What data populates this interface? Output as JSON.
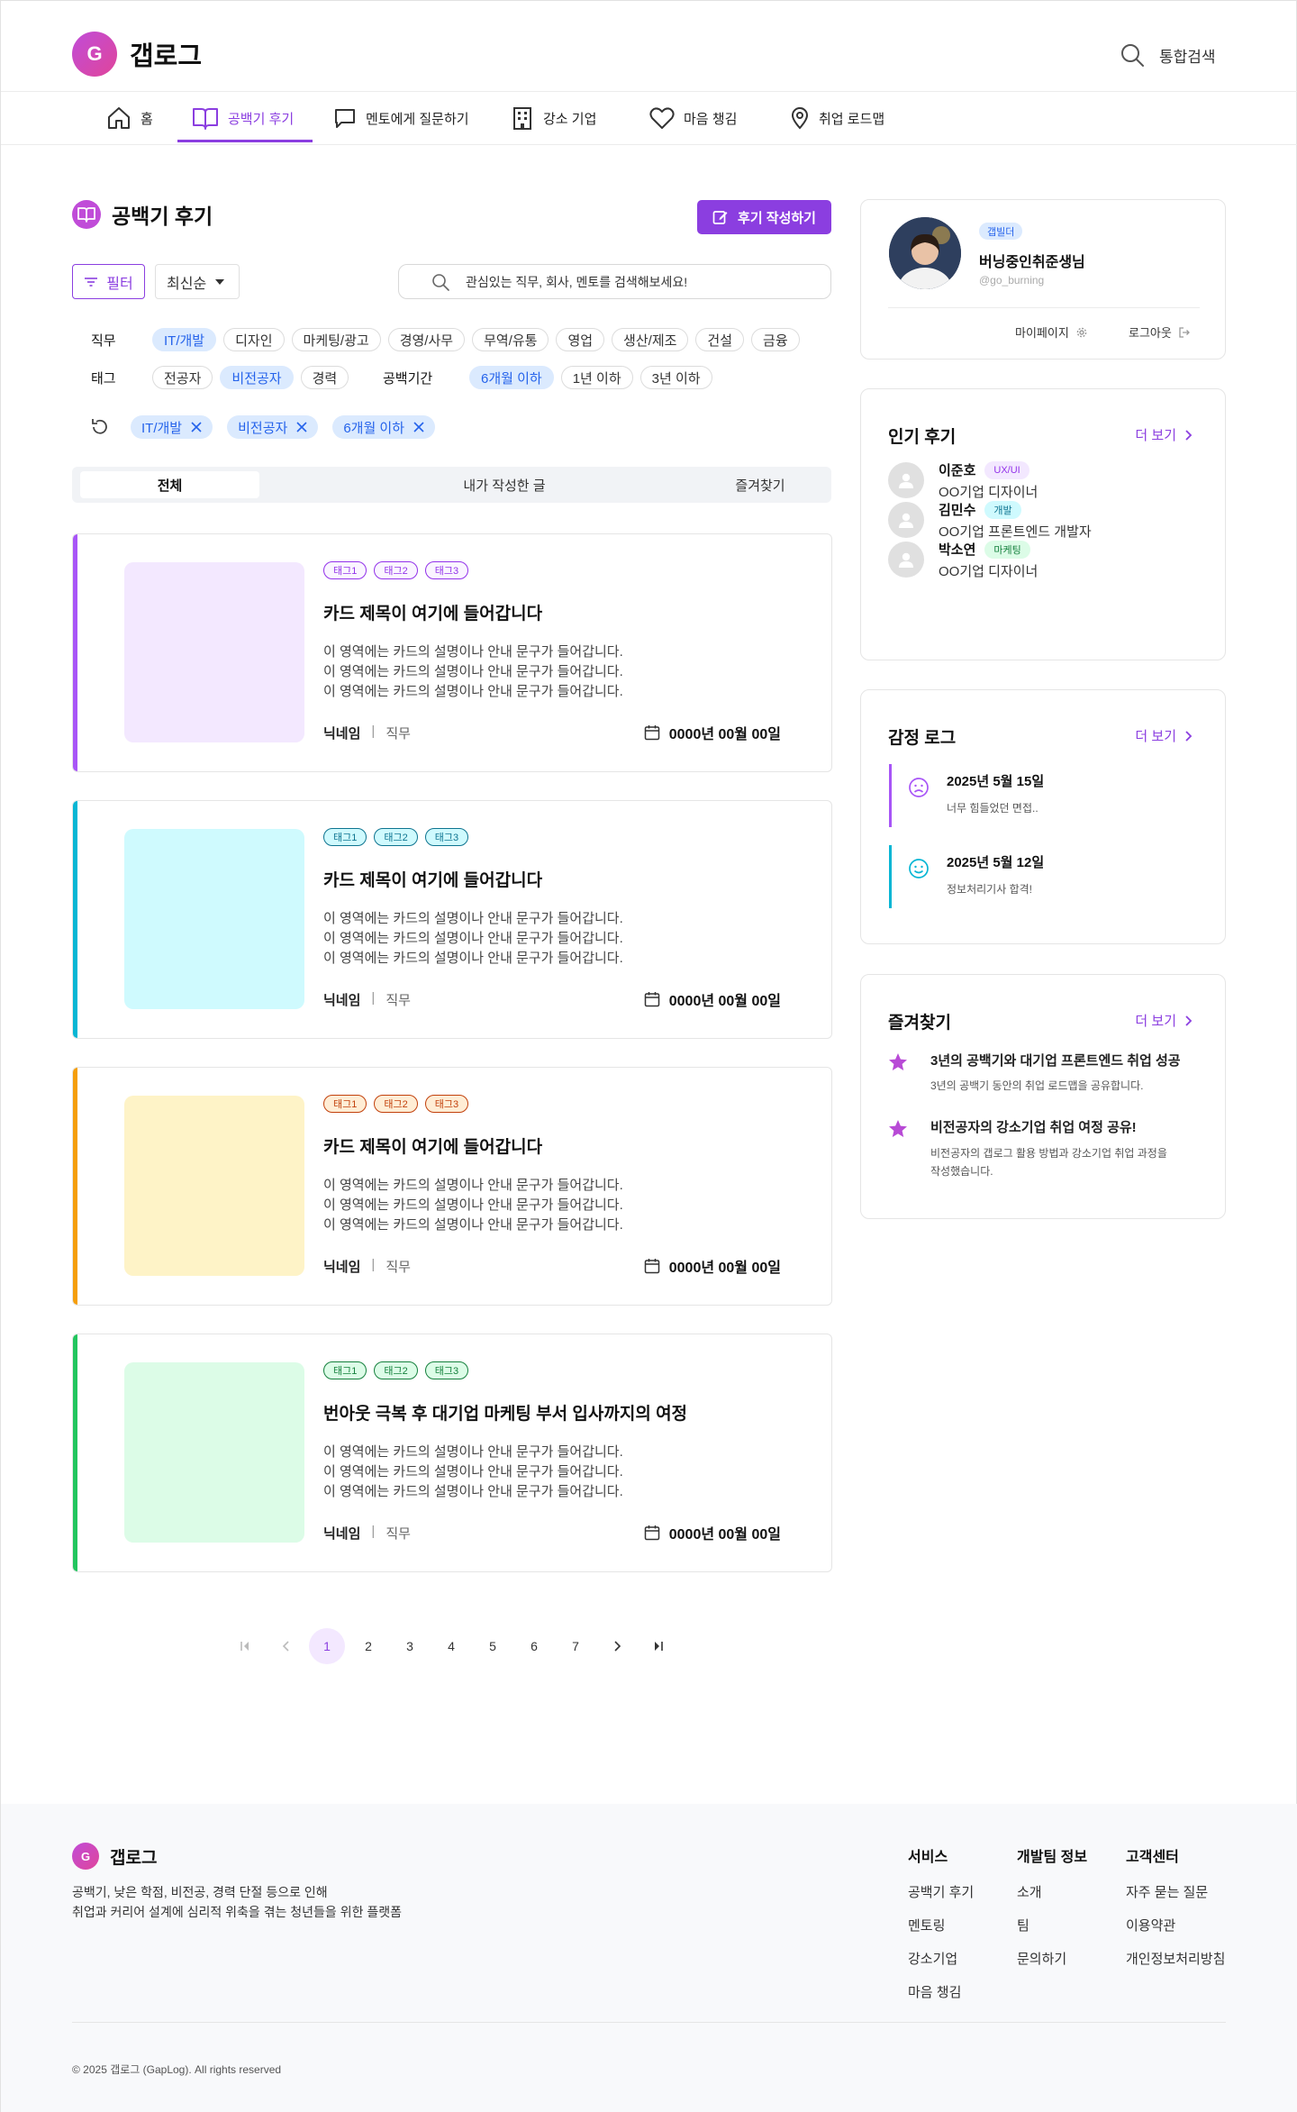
{
  "header": {
    "logo_letter": "G",
    "brand": "갭로그",
    "search_label": "통합검색"
  },
  "nav": {
    "items": [
      {
        "label": "홈"
      },
      {
        "label": "공백기 후기"
      },
      {
        "label": "멘토에게 질문하기"
      },
      {
        "label": "강소 기업"
      },
      {
        "label": "마음 챙김"
      },
      {
        "label": "취업 로드맵"
      }
    ],
    "active_index": 1
  },
  "main": {
    "page_title": "공백기 후기",
    "write_button": "후기 작성하기",
    "filter_button": "필터",
    "sort_label": "최신순",
    "search_placeholder": "관심있는 직무, 회사, 멘토를 검색해보세요!",
    "filters": {
      "job_label": "직무",
      "jobs": [
        "IT/개발",
        "디자인",
        "마케팅/광고",
        "경영/사무",
        "무역/유통",
        "영업",
        "생산/제조",
        "건설",
        "금융"
      ],
      "tag_label": "태그",
      "tags": [
        "전공자",
        "비전공자",
        "경력"
      ],
      "period_label": "공백기간",
      "periods": [
        "6개월 이하",
        "1년 이하",
        "3년 이하"
      ]
    },
    "active_chips": [
      "IT/개발",
      "비전공자",
      "6개월 이하"
    ],
    "tabs": [
      "전체",
      "내가 작성한 글",
      "즐겨찾기"
    ],
    "cards": [
      {
        "tags": [
          "태그1",
          "태그2",
          "태그3"
        ],
        "title": "카드 제목이 여기에 들어갑니다",
        "desc": [
          "이 영역에는 카드의 설명이나 안내 문구가 들어갑니다.",
          "이 영역에는 카드의 설명이나 안내 문구가 들어갑니다.",
          "이 영역에는 카드의 설명이나 안내 문구가 들어갑니다."
        ],
        "nickname": "닉네임",
        "job": "직무",
        "date": "0000년 00월 00일",
        "accent": "#a855f7",
        "thumb": "#f3e8ff",
        "tag_color": "#9333ea",
        "tag_bg": "#faf5ff"
      },
      {
        "tags": [
          "태그1",
          "태그2",
          "태그3"
        ],
        "title": "카드 제목이 여기에 들어갑니다",
        "desc": [
          "이 영역에는 카드의 설명이나 안내 문구가 들어갑니다.",
          "이 영역에는 카드의 설명이나 안내 문구가 들어갑니다.",
          "이 영역에는 카드의 설명이나 안내 문구가 들어갑니다."
        ],
        "nickname": "닉네임",
        "job": "직무",
        "date": "0000년 00월 00일",
        "accent": "#06b6d4",
        "thumb": "#cffafe",
        "tag_color": "#0e7490",
        "tag_bg": "#cffafe"
      },
      {
        "tags": [
          "태그1",
          "태그2",
          "태그3"
        ],
        "title": "카드 제목이 여기에 들어갑니다",
        "desc": [
          "이 영역에는 카드의 설명이나 안내 문구가 들어갑니다.",
          "이 영역에는 카드의 설명이나 안내 문구가 들어갑니다.",
          "이 영역에는 카드의 설명이나 안내 문구가 들어갑니다."
        ],
        "nickname": "닉네임",
        "job": "직무",
        "date": "0000년 00월 00일",
        "accent": "#f59e0b",
        "thumb": "#fef3c7",
        "tag_color": "#c2410c",
        "tag_bg": "#ffedd5"
      },
      {
        "tags": [
          "태그1",
          "태그2",
          "태그3"
        ],
        "title": "번아웃 극복 후 대기업 마케팅 부서 입사까지의 여정",
        "desc": [
          "이 영역에는 카드의 설명이나 안내 문구가 들어갑니다.",
          "이 영역에는 카드의 설명이나 안내 문구가 들어갑니다.",
          "이 영역에는 카드의 설명이나 안내 문구가 들어갑니다."
        ],
        "nickname": "닉네임",
        "job": "직무",
        "date": "0000년 00월 00일",
        "accent": "#22c55e",
        "thumb": "#dcfce7",
        "tag_color": "#15803d",
        "tag_bg": "#dcfce7"
      }
    ],
    "pagination": {
      "pages": [
        "1",
        "2",
        "3",
        "4",
        "5",
        "6",
        "7"
      ],
      "current": "1"
    }
  },
  "sidebar": {
    "profile": {
      "badge": "갭빌더",
      "name": "버닝중인취준생님",
      "handle": "@go_burning",
      "mypage": "마이페이지",
      "logout": "로그아웃"
    },
    "popular": {
      "title": "인기 후기",
      "more": "더 보기",
      "items": [
        {
          "name": "이준호",
          "role": "UX/UI",
          "desc": "OO기업 디자이너",
          "role_color": "#9333ea",
          "role_bg": "#f3e8ff"
        },
        {
          "name": "김민수",
          "role": "개발",
          "desc": "OO기업 프론트엔드 개발자",
          "role_color": "#0e7490",
          "role_bg": "#cffafe"
        },
        {
          "name": "박소연",
          "role": "마케팅",
          "desc": "OO기업 디자이너",
          "role_color": "#15803d",
          "role_bg": "#dcfce7"
        }
      ]
    },
    "emotion": {
      "title": "감정 로그",
      "more": "더 보기",
      "items": [
        {
          "date": "2025년 5월 15일",
          "text": "너무 힘들었던 면접..",
          "mood": "sad"
        },
        {
          "date": "2025년 5월 12일",
          "text": "정보처리기사 합격!",
          "mood": "happy"
        }
      ]
    },
    "favorites": {
      "title": "즐겨찾기",
      "more": "더 보기",
      "items": [
        {
          "title": "3년의 공백기와 대기업 프론트엔드 취업 성공",
          "desc": [
            "3년의 공백기 동안의 취업 로드맵을 공유합니다."
          ]
        },
        {
          "title": "비전공자의 강소기업 취업 여정 공유!",
          "desc": [
            "비전공자의 갭로그 활용 방법과 강소기업 취업 과정을",
            "작성했습니다."
          ]
        }
      ]
    }
  },
  "footer": {
    "logo_letter": "G",
    "brand": "갭로그",
    "tagline": [
      "공백기, 낮은 학점, 비전공, 경력 단절 등으로 인해",
      "취업과 커리어 설계에 심리적 위축을 겪는 청년들을 위한 플랫폼"
    ],
    "columns": [
      {
        "title": "서비스",
        "links": [
          "공백기 후기",
          "멘토링",
          "강소기업",
          "마음 챙김"
        ]
      },
      {
        "title": "개발팀 정보",
        "links": [
          "소개",
          "팀",
          "문의하기"
        ]
      },
      {
        "title": "고객센터",
        "links": [
          "자주 묻는 질문",
          "이용약관",
          "개인정보처리방침"
        ]
      }
    ],
    "copyright": "© 2025 갭로그 (GapLog). All rights reserved"
  },
  "colors": {
    "primary": "#8b3ee0",
    "blue": "#2563eb"
  }
}
